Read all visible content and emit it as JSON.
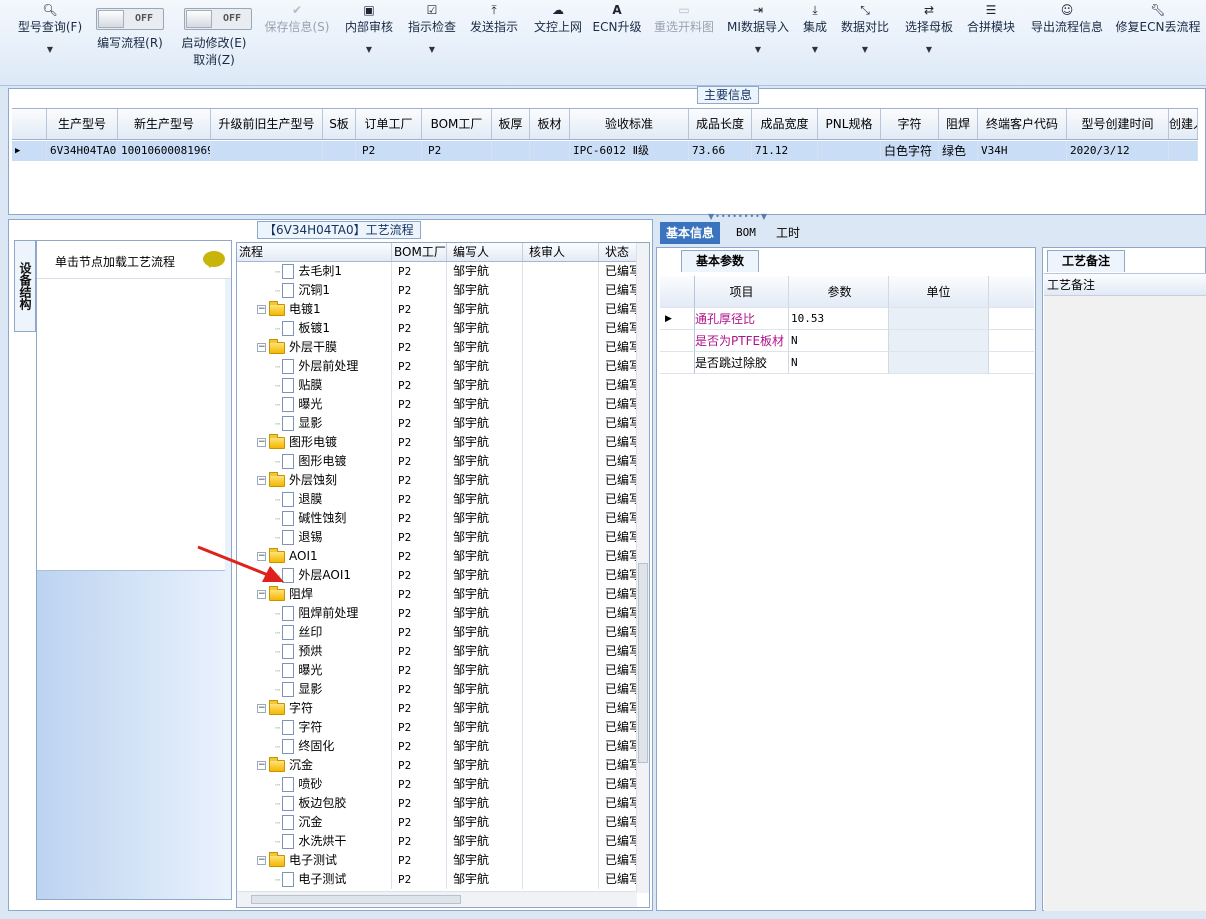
{
  "toolbar": {
    "query": {
      "label": "型号查询(F)",
      "icon": "search-icon"
    },
    "edit_flow": {
      "label": "编写流程(R)",
      "toggle": "OFF"
    },
    "start_edit": {
      "label1": "启动修改(E)",
      "label2": "取消(Z)",
      "toggle": "OFF"
    },
    "save": {
      "label": "保存信息(S)",
      "icon": "check-icon"
    },
    "internal_review": {
      "label": "内部审核",
      "icon": "printer-icon"
    },
    "instr_check": {
      "label": "指示检查",
      "icon": "checkbox-icon"
    },
    "send_instr": {
      "label": "发送指示",
      "icon": "upload-icon"
    },
    "doc_upload": {
      "label": "文控上网",
      "icon": "cloud-upload-icon"
    },
    "ecn_upgrade": {
      "label": "ECN升级",
      "icon": "font-icon"
    },
    "reselect": {
      "label": "重选开料图",
      "icon": "image-icon"
    },
    "mi_import": {
      "label": "MI数据导入",
      "icon": "import-icon"
    },
    "integrate": {
      "label": "集成",
      "icon": "download-icon"
    },
    "compare": {
      "label": "数据对比",
      "icon": "compress-icon"
    },
    "select_mother": {
      "label": "选择母板",
      "icon": "shuffle-icon"
    },
    "merge": {
      "label": "合拼模块",
      "icon": "list-icon"
    },
    "export": {
      "label": "导出流程信息",
      "icon": "smiley-icon"
    },
    "fix_ecn": {
      "label": "修复ECN丢流程",
      "icon": "wrench-icon"
    }
  },
  "main_info": {
    "title": "主要信息",
    "columns": [
      "生产型号",
      "新生产型号",
      "升级前旧生产型号",
      "S板",
      "订单工厂",
      "BOM工厂",
      "板厚",
      "板材",
      "验收标准",
      "成品长度",
      "成品宽度",
      "PNL规格",
      "字符",
      "阻焊",
      "终端客户代码",
      "型号创建时间",
      "创建人"
    ],
    "row": [
      "6V34H04TA0",
      "10010600081969",
      "",
      "",
      "P2",
      "P2",
      "",
      "",
      "IPC-6012 Ⅱ级",
      "73.66",
      "71.12",
      "",
      "白色字符",
      "绿色",
      "V34H",
      "2020/3/12",
      ""
    ]
  },
  "process": {
    "title": "【6V34H04TA0】工艺流程",
    "side_tab": "设备结构",
    "left_header": "单击节点加载工艺流程",
    "columns": [
      "流程",
      "BOM工厂",
      "编写人",
      "核审人",
      "状态"
    ],
    "rows": [
      {
        "level": 2,
        "type": "doc",
        "name": "去毛刺1",
        "bom": "P2",
        "author": "邹宇航",
        "reviewer": "",
        "status": "已编写"
      },
      {
        "level": 2,
        "type": "doc",
        "name": "沉铜1",
        "bom": "P2",
        "author": "邹宇航",
        "reviewer": "",
        "status": "已编写"
      },
      {
        "level": 1,
        "type": "folder",
        "name": "电镀1",
        "bom": "P2",
        "author": "邹宇航",
        "reviewer": "",
        "status": "已编写"
      },
      {
        "level": 2,
        "type": "doc",
        "name": "板镀1",
        "bom": "P2",
        "author": "邹宇航",
        "reviewer": "",
        "status": "已编写"
      },
      {
        "level": 1,
        "type": "folder",
        "name": "外层干膜",
        "bom": "P2",
        "author": "邹宇航",
        "reviewer": "",
        "status": "已编写"
      },
      {
        "level": 2,
        "type": "doc",
        "name": "外层前处理",
        "bom": "P2",
        "author": "邹宇航",
        "reviewer": "",
        "status": "已编写"
      },
      {
        "level": 2,
        "type": "doc",
        "name": "贴膜",
        "bom": "P2",
        "author": "邹宇航",
        "reviewer": "",
        "status": "已编写"
      },
      {
        "level": 2,
        "type": "doc",
        "name": "曝光",
        "bom": "P2",
        "author": "邹宇航",
        "reviewer": "",
        "status": "已编写"
      },
      {
        "level": 2,
        "type": "doc",
        "name": "显影",
        "bom": "P2",
        "author": "邹宇航",
        "reviewer": "",
        "status": "已编写"
      },
      {
        "level": 1,
        "type": "folder",
        "name": "图形电镀",
        "bom": "P2",
        "author": "邹宇航",
        "reviewer": "",
        "status": "已编写"
      },
      {
        "level": 2,
        "type": "doc",
        "name": "图形电镀",
        "bom": "P2",
        "author": "邹宇航",
        "reviewer": "",
        "status": "已编写"
      },
      {
        "level": 1,
        "type": "folder",
        "name": "外层蚀刻",
        "bom": "P2",
        "author": "邹宇航",
        "reviewer": "",
        "status": "已编写"
      },
      {
        "level": 2,
        "type": "doc",
        "name": "退膜",
        "bom": "P2",
        "author": "邹宇航",
        "reviewer": "",
        "status": "已编写"
      },
      {
        "level": 2,
        "type": "doc",
        "name": "碱性蚀刻",
        "bom": "P2",
        "author": "邹宇航",
        "reviewer": "",
        "status": "已编写"
      },
      {
        "level": 2,
        "type": "doc",
        "name": "退锡",
        "bom": "P2",
        "author": "邹宇航",
        "reviewer": "",
        "status": "已编写"
      },
      {
        "level": 1,
        "type": "folder",
        "name": "AOI1",
        "bom": "P2",
        "author": "邹宇航",
        "reviewer": "",
        "status": "已编写"
      },
      {
        "level": 2,
        "type": "doc",
        "name": "外层AOI1",
        "bom": "P2",
        "author": "邹宇航",
        "reviewer": "",
        "status": "已编写"
      },
      {
        "level": 1,
        "type": "folder",
        "name": "阻焊",
        "bom": "P2",
        "author": "邹宇航",
        "reviewer": "",
        "status": "已编写"
      },
      {
        "level": 2,
        "type": "doc",
        "name": "阻焊前处理",
        "bom": "P2",
        "author": "邹宇航",
        "reviewer": "",
        "status": "已编写"
      },
      {
        "level": 2,
        "type": "doc",
        "name": "丝印",
        "bom": "P2",
        "author": "邹宇航",
        "reviewer": "",
        "status": "已编写"
      },
      {
        "level": 2,
        "type": "doc",
        "name": "预烘",
        "bom": "P2",
        "author": "邹宇航",
        "reviewer": "",
        "status": "已编写"
      },
      {
        "level": 2,
        "type": "doc",
        "name": "曝光",
        "bom": "P2",
        "author": "邹宇航",
        "reviewer": "",
        "status": "已编写"
      },
      {
        "level": 2,
        "type": "doc",
        "name": "显影",
        "bom": "P2",
        "author": "邹宇航",
        "reviewer": "",
        "status": "已编写"
      },
      {
        "level": 1,
        "type": "folder",
        "name": "字符",
        "bom": "P2",
        "author": "邹宇航",
        "reviewer": "",
        "status": "已编写"
      },
      {
        "level": 2,
        "type": "doc",
        "name": "字符",
        "bom": "P2",
        "author": "邹宇航",
        "reviewer": "",
        "status": "已编写"
      },
      {
        "level": 2,
        "type": "doc",
        "name": "终固化",
        "bom": "P2",
        "author": "邹宇航",
        "reviewer": "",
        "status": "已编写"
      },
      {
        "level": 1,
        "type": "folder",
        "name": "沉金",
        "bom": "P2",
        "author": "邹宇航",
        "reviewer": "",
        "status": "已编写"
      },
      {
        "level": 2,
        "type": "doc",
        "name": "喷砂",
        "bom": "P2",
        "author": "邹宇航",
        "reviewer": "",
        "status": "已编写"
      },
      {
        "level": 2,
        "type": "doc",
        "name": "板边包胶",
        "bom": "P2",
        "author": "邹宇航",
        "reviewer": "",
        "status": "已编写"
      },
      {
        "level": 2,
        "type": "doc",
        "name": "沉金",
        "bom": "P2",
        "author": "邹宇航",
        "reviewer": "",
        "status": "已编写"
      },
      {
        "level": 2,
        "type": "doc",
        "name": "水洗烘干",
        "bom": "P2",
        "author": "邹宇航",
        "reviewer": "",
        "status": "已编写"
      },
      {
        "level": 1,
        "type": "folder",
        "name": "电子测试",
        "bom": "P2",
        "author": "邹宇航",
        "reviewer": "",
        "status": "已编写"
      },
      {
        "level": 2,
        "type": "doc",
        "name": "电子测试",
        "bom": "P2",
        "author": "邹宇航",
        "reviewer": "",
        "status": "已编写"
      }
    ]
  },
  "right": {
    "tabs": [
      "基本信息",
      "BOM",
      "工时"
    ],
    "subtab": "基本参数",
    "columns": [
      "项目",
      "参数",
      "单位"
    ],
    "rows": [
      {
        "item": "通孔厚径比",
        "value": "10.53",
        "unit": ""
      },
      {
        "item": "是否为PTFE板材",
        "value": "N",
        "unit": ""
      },
      {
        "item": "是否跳过除胶",
        "value": "N",
        "unit": ""
      }
    ],
    "note_tab": "工艺备注",
    "note_header": "工艺备注"
  },
  "colors": {
    "accent": "#3a73be",
    "selected_row": "#c9def6",
    "arrow": "#e0201a"
  }
}
